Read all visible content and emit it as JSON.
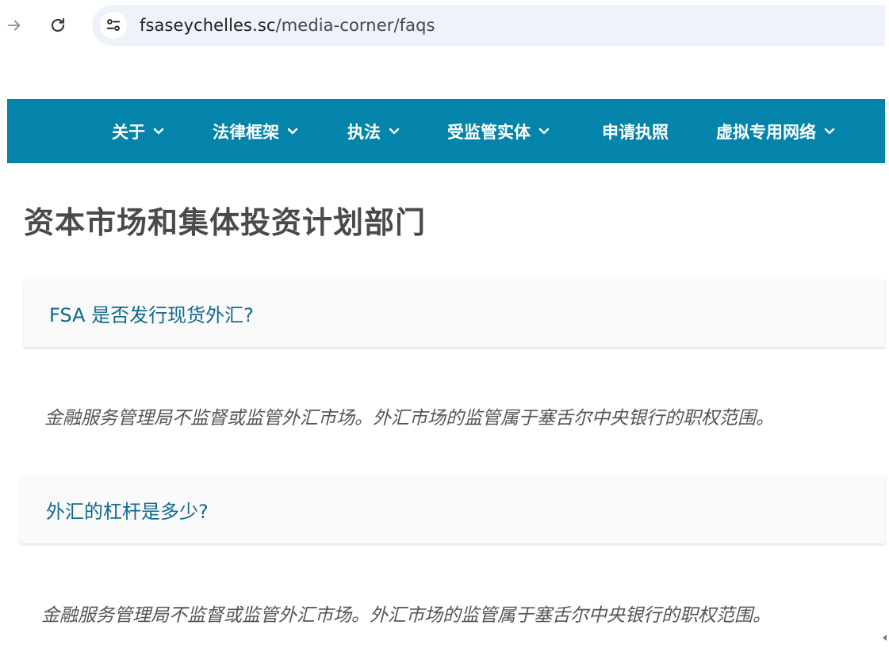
{
  "browser": {
    "url_host": "fsaseychelles.sc",
    "url_path": "/media-corner/faqs",
    "icons": {
      "forward": "arrow-right-icon",
      "reload": "reload-icon",
      "site_info": "tune-icon"
    }
  },
  "nav": {
    "items": [
      {
        "label": "关于",
        "has_dropdown": true
      },
      {
        "label": "法律框架",
        "has_dropdown": true
      },
      {
        "label": "执法",
        "has_dropdown": true
      },
      {
        "label": "受监管实体",
        "has_dropdown": true
      },
      {
        "label": "申请执照",
        "has_dropdown": false
      },
      {
        "label": "虚拟专用网络",
        "has_dropdown": true
      }
    ],
    "colors": {
      "background": "#0584ab",
      "text": "#ffffff"
    }
  },
  "page": {
    "title": "资本市场和集体投资计划部门"
  },
  "faqs": [
    {
      "question": "FSA 是否发行现货外汇?",
      "answer": "金融服务管理局不监督或监管外汇市场。外汇市场的监管属于塞舌尔中央银行的职权范围。"
    },
    {
      "question": "外汇的杠杆是多少?",
      "answer": "金融服务管理局不监督或监管外汇市场。外汇市场的监管属于塞舌尔中央银行的职权范围。"
    }
  ],
  "colors": {
    "question_text": "#0f6a8f",
    "answer_text": "#555555",
    "title_text": "#4a4a4a"
  }
}
